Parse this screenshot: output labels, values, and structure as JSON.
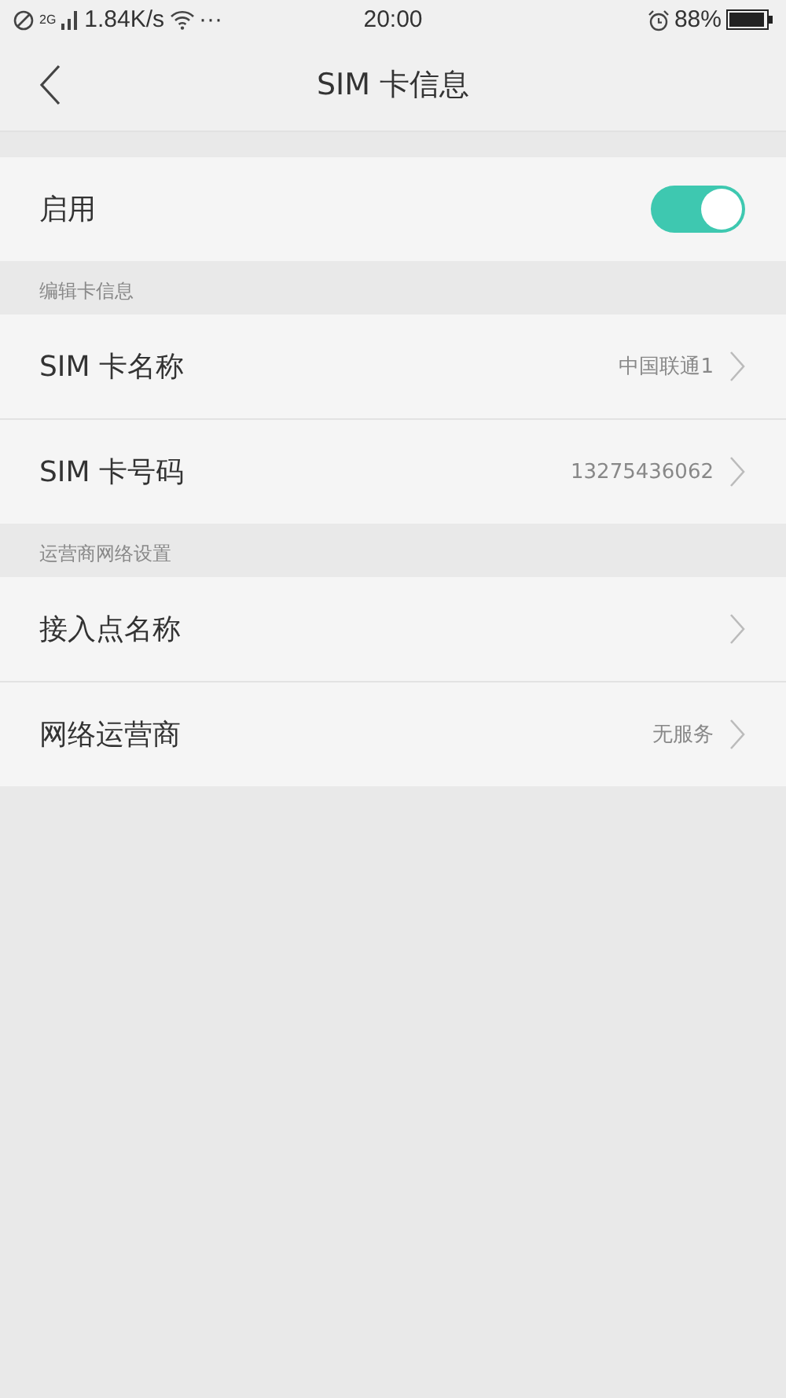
{
  "status_bar": {
    "network_type": "2G",
    "speed": "1.84K/s",
    "more": "···",
    "time": "20:00",
    "battery": "88%"
  },
  "nav": {
    "title": "SIM 卡信息"
  },
  "groups": [
    {
      "items": [
        {
          "kind": "switch",
          "label": "启用",
          "on": true
        }
      ]
    },
    {
      "header": "编辑卡信息",
      "items": [
        {
          "kind": "link",
          "label": "SIM 卡名称",
          "value": "中国联通1"
        },
        {
          "kind": "link",
          "label": "SIM 卡号码",
          "value": "13275436062"
        }
      ]
    },
    {
      "header": "运营商网络设置",
      "items": [
        {
          "kind": "link",
          "label": "接入点名称"
        },
        {
          "kind": "link",
          "label": "网络运营商",
          "value": "无服务"
        }
      ]
    }
  ]
}
